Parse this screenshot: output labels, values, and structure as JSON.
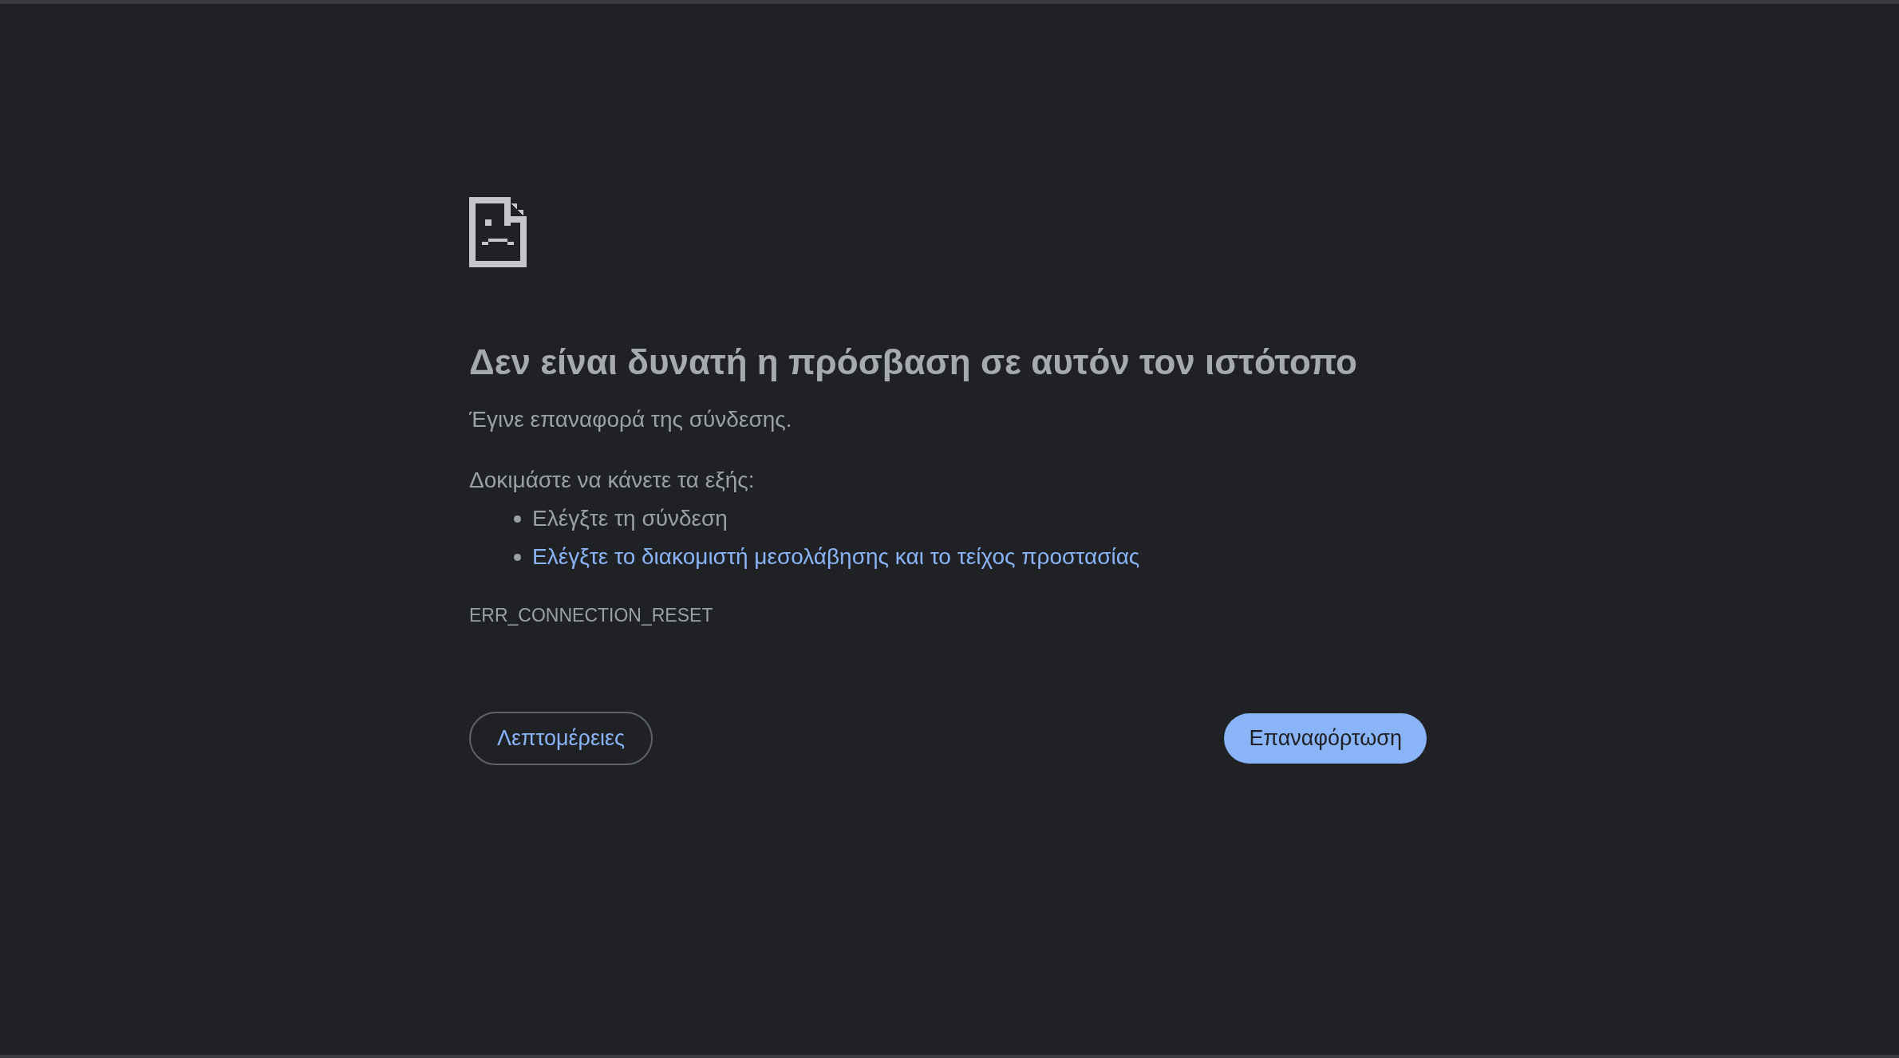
{
  "error_page": {
    "title": "Δεν είναι δυνατή η πρόσβαση σε αυτόν τον ιστότοπο",
    "message": "Έγινε επαναφορά της σύνδεσης.",
    "suggestions_heading": "Δοκιμάστε να κάνετε τα εξής:",
    "suggestions": [
      {
        "text": "Ελέγξτε τη σύνδεση",
        "kind": "text"
      },
      {
        "text": "Ελέγξτε το διακομιστή μεσολάβησης και το τείχος προστασίας",
        "kind": "link"
      }
    ],
    "error_code": "ERR_CONNECTION_RESET",
    "details_button": "Λεπτομέρειες",
    "reload_button": "Επαναφόρτωση"
  }
}
